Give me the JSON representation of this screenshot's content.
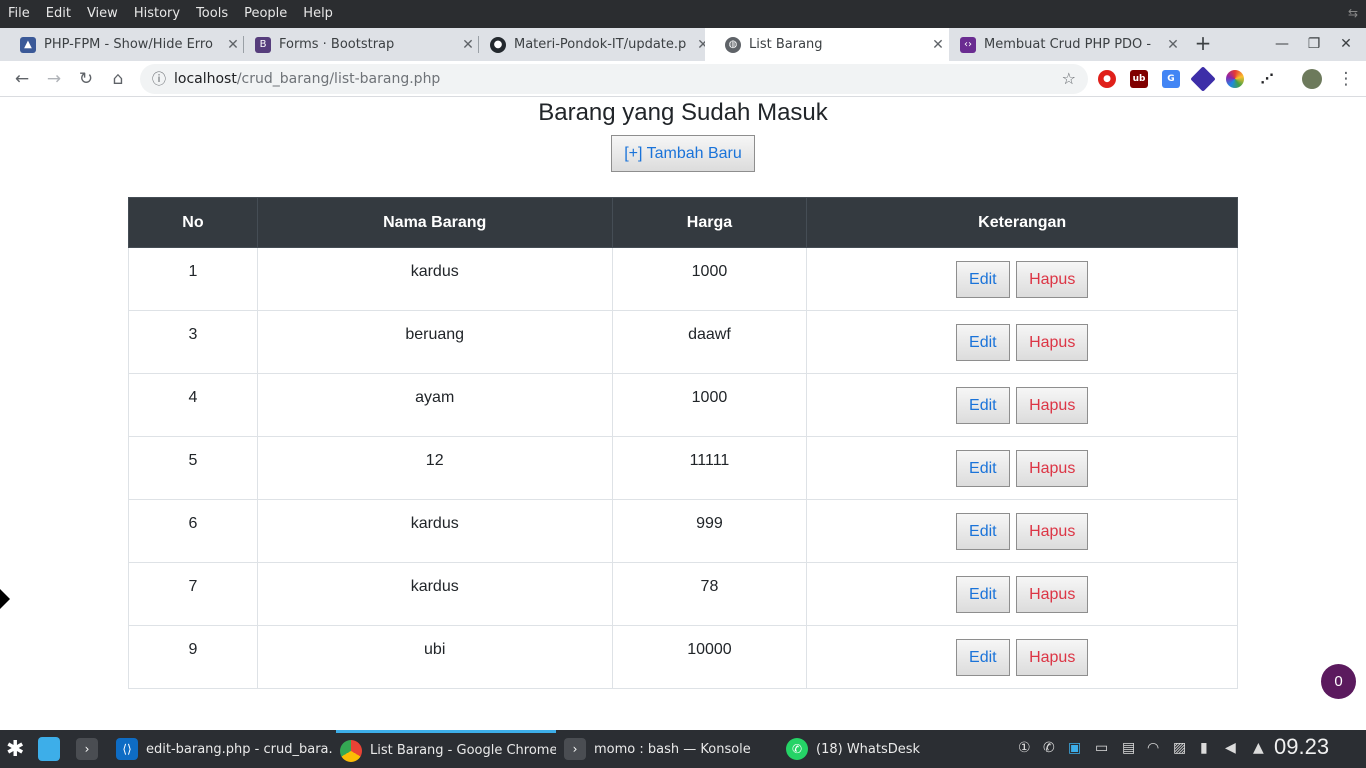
{
  "menubar": {
    "items": [
      "File",
      "Edit",
      "View",
      "History",
      "Tools",
      "People",
      "Help"
    ]
  },
  "tabs": [
    {
      "title": "PHP-FPM - Show/Hide Erro",
      "icon": "php-icon"
    },
    {
      "title": "Forms · Bootstrap",
      "icon": "bootstrap-icon"
    },
    {
      "title": "Materi-Pondok-IT/update.p",
      "icon": "github-icon"
    },
    {
      "title": "List Barang",
      "icon": "globe-icon"
    },
    {
      "title": "Membuat Crud PHP PDO -",
      "icon": "code-icon"
    }
  ],
  "omnibox": {
    "host": "localhost",
    "path": "/crud_barang/list-barang.php"
  },
  "page": {
    "heading": "Barang yang Sudah Masuk",
    "add_button": "[+] Tambah Baru",
    "columns": [
      "No",
      "Nama Barang",
      "Harga",
      "Keterangan"
    ],
    "rows": [
      {
        "no": "1",
        "nama": "kardus",
        "harga": "1000"
      },
      {
        "no": "3",
        "nama": "beruang",
        "harga": "daawf"
      },
      {
        "no": "4",
        "nama": "ayam",
        "harga": "1000"
      },
      {
        "no": "5",
        "nama": "12",
        "harga": "11111"
      },
      {
        "no": "6",
        "nama": "kardus",
        "harga": "999"
      },
      {
        "no": "7",
        "nama": "kardus",
        "harga": "78"
      },
      {
        "no": "9",
        "nama": "ubi",
        "harga": "10000"
      }
    ],
    "edit_label": "Edit",
    "delete_label": "Hapus",
    "notification_count": "0"
  },
  "taskbar": {
    "items": [
      {
        "label": "edit-barang.php - crud_bara...",
        "icon": "vscode-icon"
      },
      {
        "label": "List Barang - Google Chrome",
        "icon": "chrome-icon"
      },
      {
        "label": "momo : bash — Konsole",
        "icon": "terminal-icon"
      },
      {
        "label": "(18) WhatsDesk",
        "icon": "whatsapp-icon"
      }
    ],
    "clock": "09.23"
  },
  "colors": {
    "table_header": "#343a40",
    "link_blue": "#1a73d9",
    "danger_red": "#dc3545",
    "taskbar": "#2b2e33"
  }
}
